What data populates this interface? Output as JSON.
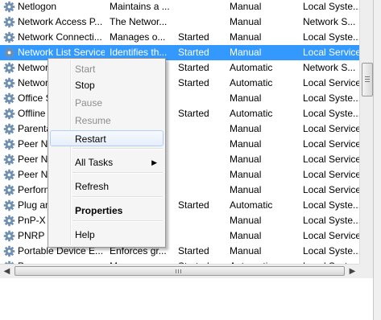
{
  "services": [
    {
      "name": "Netlogon",
      "description": "Maintains a ...",
      "status": "",
      "startup_type": "Manual",
      "log_on_as": "Local Syste..."
    },
    {
      "name": "Network Access P...",
      "description": "The Networ...",
      "status": "",
      "startup_type": "Manual",
      "log_on_as": "Network S..."
    },
    {
      "name": "Network Connecti...",
      "description": "Manages o...",
      "status": "Started",
      "startup_type": "Manual",
      "log_on_as": "Local Syste..."
    },
    {
      "name": "Network List Service",
      "description": "Identifies th...",
      "status": "Started",
      "startup_type": "Manual",
      "log_on_as": "Local Service",
      "selected": true
    },
    {
      "name": "Network Location Awareness",
      "description": "",
      "status": "Started",
      "startup_type": "Automatic",
      "log_on_as": "Network S..."
    },
    {
      "name": "Network Store Interface Service",
      "description": "",
      "status": "Started",
      "startup_type": "Automatic",
      "log_on_as": "Local Service"
    },
    {
      "name": "Office Software Protection",
      "description": "",
      "status": "",
      "startup_type": "Manual",
      "log_on_as": "Local Syste..."
    },
    {
      "name": "Offline Files",
      "description": "",
      "status": "Started",
      "startup_type": "Automatic",
      "log_on_as": "Local Syste..."
    },
    {
      "name": "Parental Controls",
      "description": "",
      "status": "",
      "startup_type": "Manual",
      "log_on_as": "Local Service"
    },
    {
      "name": "Peer Name Resolution Protocol",
      "description": "",
      "status": "",
      "startup_type": "Manual",
      "log_on_as": "Local Service"
    },
    {
      "name": "Peer Networking Grouping",
      "description": "",
      "status": "",
      "startup_type": "Manual",
      "log_on_as": "Local Service"
    },
    {
      "name": "Peer Networking Identity Manager",
      "description": "",
      "status": "",
      "startup_type": "Manual",
      "log_on_as": "Local Service"
    },
    {
      "name": "Performance Logs & Alerts",
      "description": "",
      "status": "",
      "startup_type": "Manual",
      "log_on_as": "Local Service"
    },
    {
      "name": "Plug and Play",
      "description": "",
      "status": "Started",
      "startup_type": "Automatic",
      "log_on_as": "Local Syste..."
    },
    {
      "name": "PnP-X IP Bus Enumerator",
      "description": "",
      "status": "",
      "startup_type": "Manual",
      "log_on_as": "Local Syste..."
    },
    {
      "name": "PNRP Machine Name Publication",
      "description": "",
      "status": "",
      "startup_type": "Manual",
      "log_on_as": "Local Service"
    },
    {
      "name": "Portable Device E...",
      "description": "Enforces gr...",
      "status": "Started",
      "startup_type": "Manual",
      "log_on_as": "Local Syste..."
    },
    {
      "name": "Power",
      "description": "Manages p...",
      "status": "Started",
      "startup_type": "Automatic",
      "log_on_as": "Local Syste..."
    }
  ],
  "context_menu": {
    "items": [
      {
        "label": "Start",
        "disabled": true
      },
      {
        "label": "Stop",
        "disabled": false
      },
      {
        "label": "Pause",
        "disabled": true
      },
      {
        "label": "Resume",
        "disabled": true
      },
      {
        "label": "Restart",
        "disabled": false,
        "highlighted": true
      },
      {
        "label": "All Tasks",
        "disabled": false,
        "submenu": true
      },
      {
        "label": "Refresh",
        "disabled": false
      },
      {
        "label": "Properties",
        "disabled": false,
        "bold": true
      },
      {
        "label": "Help",
        "disabled": false
      }
    ]
  },
  "colors": {
    "selection": "#3399ff",
    "gear_icon": "#6e8fb0",
    "menu_background": "#f5f5f5",
    "menu_hover_border": "#aecff7"
  },
  "icons": {
    "service": "gear-icon",
    "submenu": "submenu-arrow-icon",
    "scroll_left": "scroll-left-arrow-icon",
    "scroll_right": "scroll-right-arrow-icon"
  }
}
